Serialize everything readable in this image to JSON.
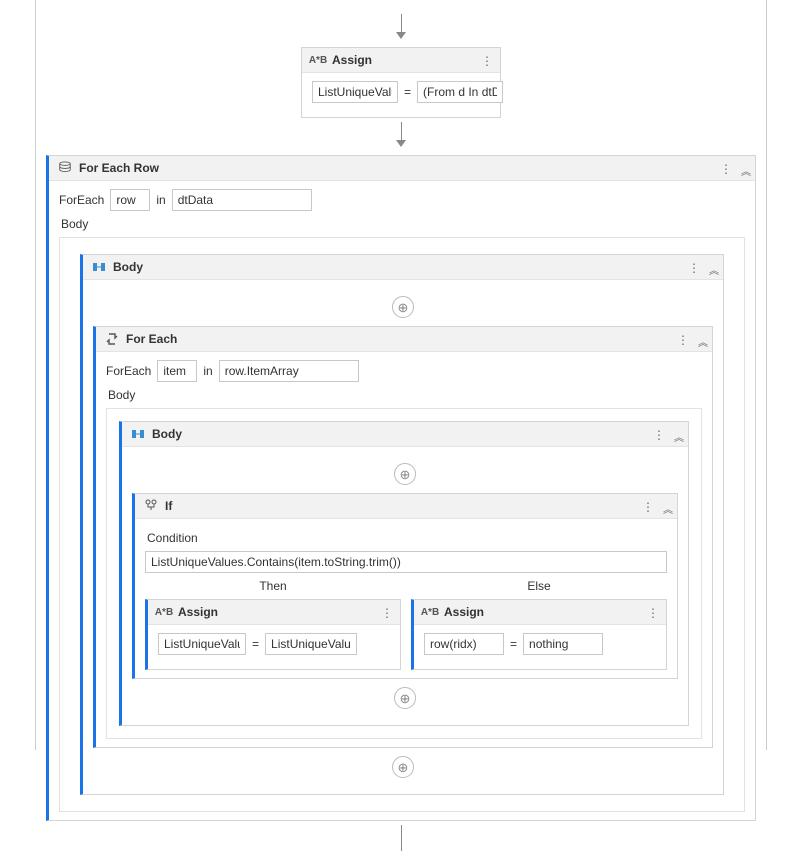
{
  "topAssign": {
    "title": "Assign",
    "lhs": "ListUniqueValues",
    "rhs": "(From d In dtData."
  },
  "forEachRow": {
    "title": "For Each Row",
    "prefix": "ForEach",
    "varName": "row",
    "inWord": "in",
    "collection": "dtData",
    "bodyLabel": "Body"
  },
  "bodySeq1": {
    "title": "Body"
  },
  "forEach": {
    "title": "For Each",
    "prefix": "ForEach",
    "varName": "item",
    "inWord": "in",
    "collection": "row.ItemArray",
    "bodyLabel": "Body"
  },
  "bodySeq2": {
    "title": "Body"
  },
  "ifAct": {
    "title": "If",
    "conditionLabel": "Condition",
    "condition": "ListUniqueValues.Contains(item.toString.trim())",
    "thenLabel": "Then",
    "elseLabel": "Else"
  },
  "thenAssign": {
    "title": "Assign",
    "lhs": "ListUniqueValues",
    "rhs": "ListUniqueValues.E"
  },
  "elseAssign": {
    "title": "Assign",
    "lhs": "row(ridx)",
    "rhs": "nothing"
  },
  "glyphs": {
    "assign": "A*B",
    "if": "⚖",
    "loop": "↻",
    "seq": "▭"
  },
  "colors": {
    "accent": "#1a73e8"
  }
}
